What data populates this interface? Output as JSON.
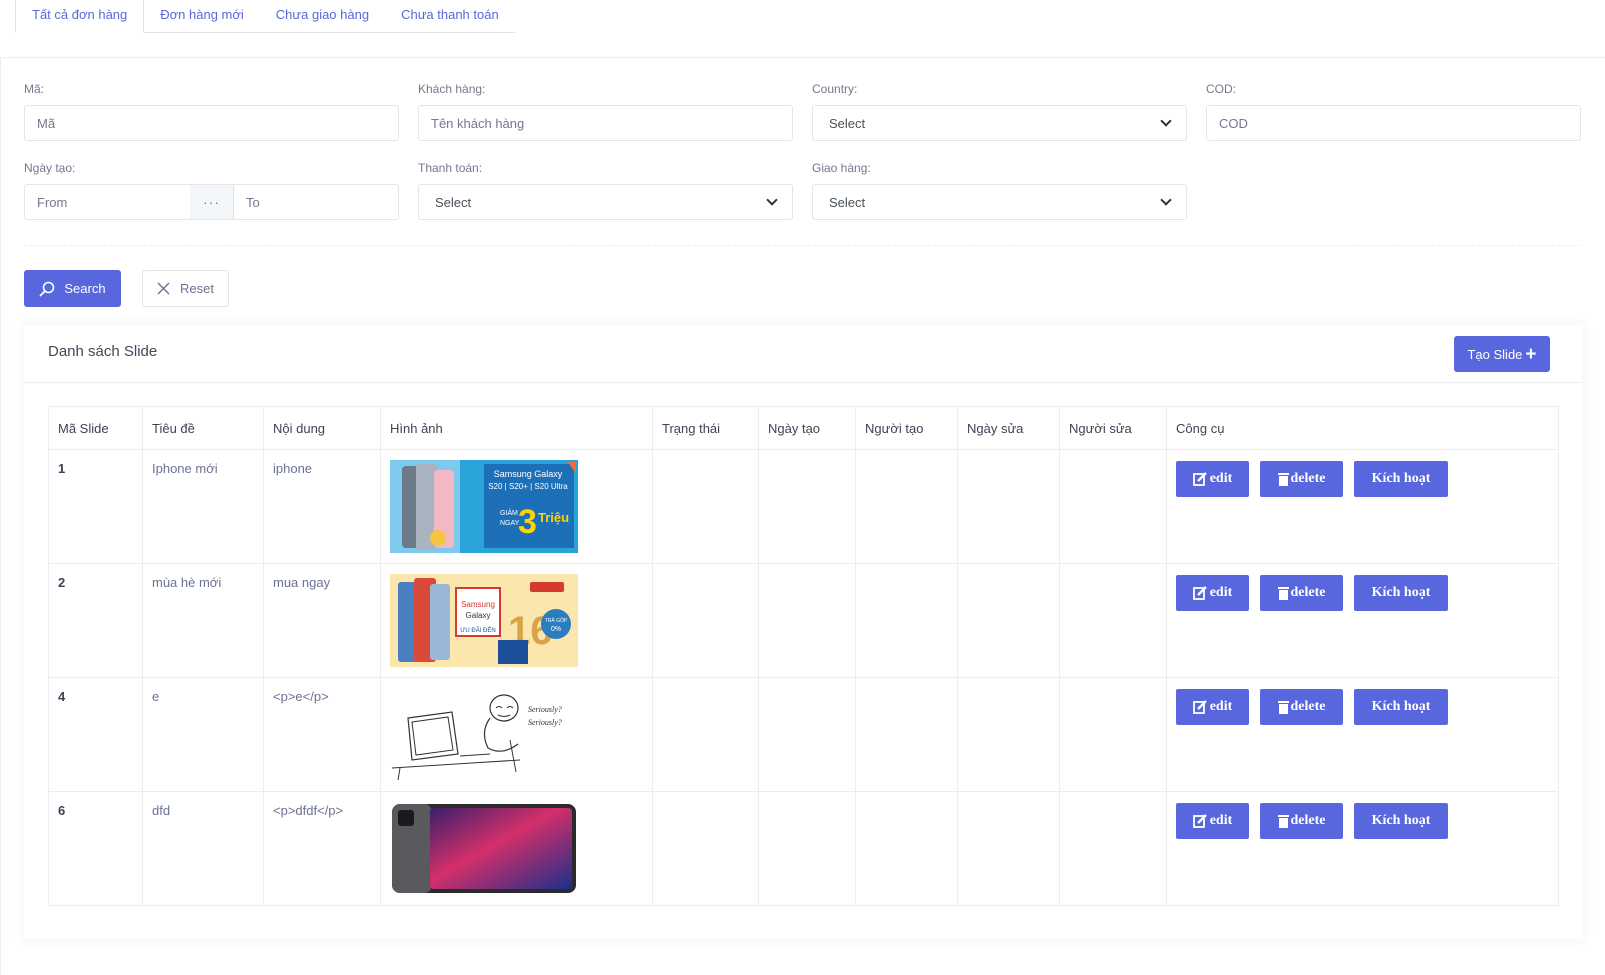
{
  "tabs": [
    {
      "label": "Tất cả đơn hàng"
    },
    {
      "label": "Đơn hàng mới"
    },
    {
      "label": "Chưa giao hàng"
    },
    {
      "label": "Chưa thanh toán"
    }
  ],
  "filters": {
    "ma": {
      "label": "Mã:",
      "placeholder": "Mã"
    },
    "khach_hang": {
      "label": "Khách hàng:",
      "placeholder": "Tên khách hàng"
    },
    "country": {
      "label": "Country:",
      "value": "Select"
    },
    "cod": {
      "label": "COD:",
      "placeholder": "COD"
    },
    "ngay_tao": {
      "label": "Ngày tạo:",
      "from_placeholder": "From",
      "separator": "···",
      "to_placeholder": "To"
    },
    "thanh_toan": {
      "label": "Thanh toán:",
      "value": "Select"
    },
    "giao_hang": {
      "label": "Giao hàng:",
      "value": "Select"
    }
  },
  "actions": {
    "search_label": "Search",
    "reset_label": "Reset"
  },
  "card": {
    "title": "Danh sách Slide",
    "create_label": "Tạo Slide"
  },
  "table": {
    "columns": [
      "Mã Slide",
      "Tiêu đề",
      "Nội dung",
      "Hình ảnh",
      "Trạng thái",
      "Ngày tạo",
      "Người tạo",
      "Ngày sửa",
      "Người sửa",
      "Công cụ"
    ],
    "rows": [
      {
        "id": "1",
        "title": "Iphone mới",
        "content": "iphone",
        "image": "samsung-galaxy-s20-banner"
      },
      {
        "id": "2",
        "title": "mùa hè mới",
        "content": "mua ngay",
        "image": "samsung-galaxy-16-banner"
      },
      {
        "id": "4",
        "title": "e",
        "content": "<p>e</p>",
        "image": "seriously-meme-sketch"
      },
      {
        "id": "6",
        "title": "dfd",
        "content": "<p>dfdf</p>",
        "image": "ipad-pro-photo"
      }
    ],
    "tool_labels": {
      "edit": "edit",
      "delete": "delete",
      "activate": "Kích hoạt"
    }
  },
  "banner_text": {
    "s20_line1": "Samsung Galaxy",
    "s20_line2": "S20 | S20+ | S20 Ultra",
    "s20_giam": "GIẢM",
    "s20_ngay": "NGAY",
    "s20_big": "3",
    "s20_trieu": "Triệu",
    "a_brand": "Samsung",
    "a_galaxy": "Galaxy",
    "a_uudai": "ƯU ĐÃI ĐẾN",
    "a_num": "16",
    "a_tragop": "TRẢ GÓP",
    "a_zero": "0%",
    "meme_line1": "Seriously?",
    "meme_line2": "Seriously?"
  },
  "colors": {
    "primary": "#5867dd",
    "border": "#ebedf3",
    "muted": "#74788d"
  }
}
